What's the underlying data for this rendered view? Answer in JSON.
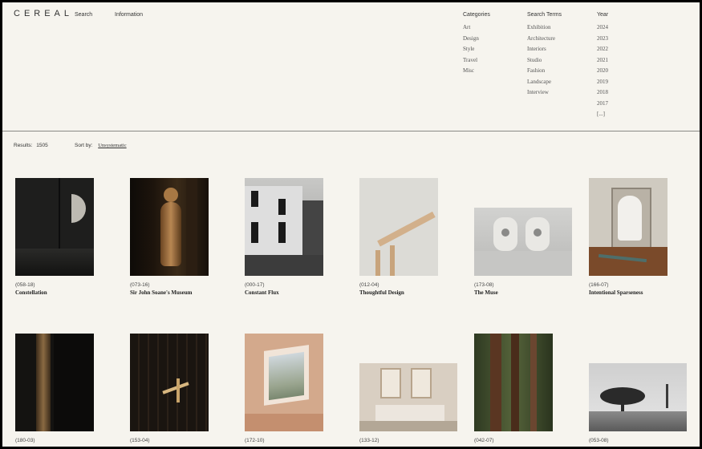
{
  "header": {
    "logo": "CEREAL",
    "nav": [
      "Search",
      "Information"
    ],
    "categories": {
      "heading": "Categories",
      "items": [
        "Art",
        "Design",
        "Style",
        "Travel",
        "Misc"
      ]
    },
    "search_terms": {
      "heading": "Search Terms",
      "items": [
        "Exhibition",
        "Architecture",
        "Interiors",
        "Studio",
        "Fashion",
        "Landscape",
        "Interview"
      ]
    },
    "year": {
      "heading": "Year",
      "items": [
        "2024",
        "2023",
        "2022",
        "2021",
        "2020",
        "2019",
        "2018",
        "2017",
        "[...]"
      ]
    }
  },
  "toolbar": {
    "results_label": "Results:",
    "results_count": "1505",
    "sort_label": "Sort by:",
    "sort_value": "Unsystematic"
  },
  "cards": [
    {
      "code": "(058-18)",
      "title": "Constellation"
    },
    {
      "code": "(073-16)",
      "title": "Sir John Soane's Museum"
    },
    {
      "code": "(000-17)",
      "title": "Constant Flux"
    },
    {
      "code": "(012-04)",
      "title": "Thoughtful Design"
    },
    {
      "code": "(173-08)",
      "title": "The Muse"
    },
    {
      "code": "(166-07)",
      "title": "Intentional Sparseness"
    },
    {
      "code": "(180-03)",
      "title": ""
    },
    {
      "code": "(153-04)",
      "title": ""
    },
    {
      "code": "(172-10)",
      "title": ""
    },
    {
      "code": "(133-12)",
      "title": ""
    },
    {
      "code": "(042-07)",
      "title": ""
    },
    {
      "code": "(053-08)",
      "title": ""
    }
  ]
}
